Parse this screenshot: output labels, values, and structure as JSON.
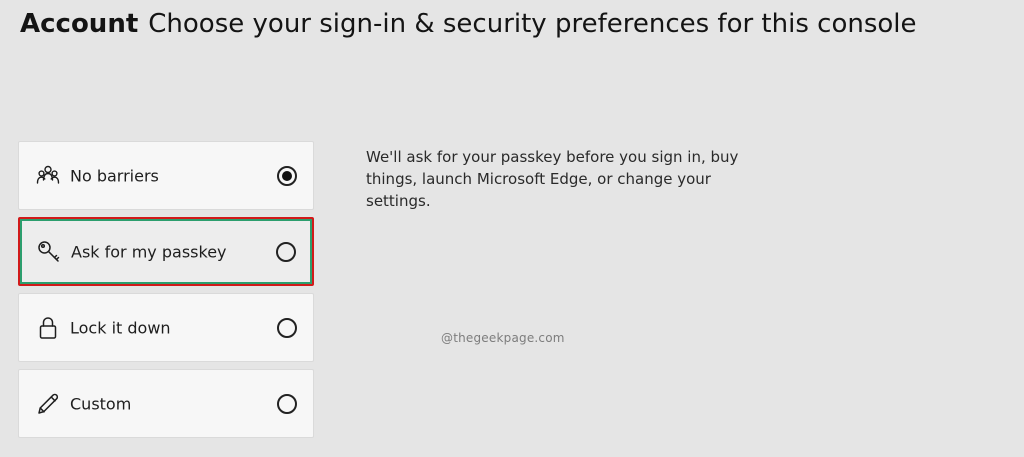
{
  "header": {
    "section": "Account",
    "title": "Choose your sign-in & security preferences for this console"
  },
  "options": [
    {
      "label": "No barriers",
      "icon": "people-icon",
      "selected": true
    },
    {
      "label": "Ask for my passkey",
      "icon": "key-icon",
      "selected": false,
      "highlighted": true
    },
    {
      "label": "Lock it down",
      "icon": "lock-icon",
      "selected": false
    },
    {
      "label": "Custom",
      "icon": "pencil-icon",
      "selected": false
    }
  ],
  "description": "We'll ask for your passkey before you sign in, buy things, launch Microsoft Edge, or change your settings.",
  "watermark": "@thegeekpage.com",
  "colors": {
    "background": "#e5e5e5",
    "card": "#f7f7f7",
    "highlight_border": "#d11a1a",
    "focus_ring": "#2c9e6e"
  }
}
